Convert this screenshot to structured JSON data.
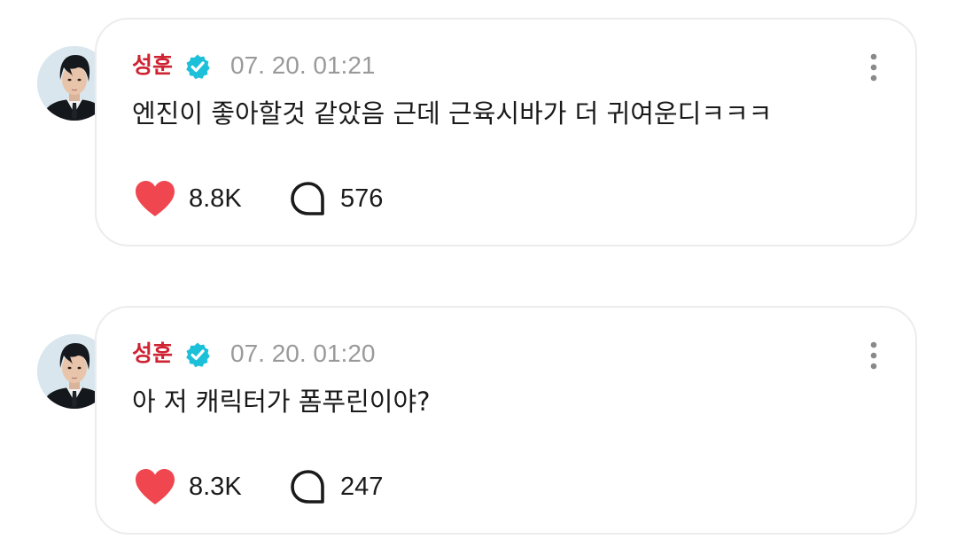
{
  "posts": [
    {
      "author": "성훈",
      "verified_icon": "verified-check-badge",
      "timestamp": "07. 20. 01:21",
      "text": "엔진이 좋아할것 같았음 근데 근육시바가 더 귀여운디ㅋㅋㅋ",
      "likes": "8.8K",
      "comments": "576"
    },
    {
      "author": "성훈",
      "verified_icon": "verified-check-badge",
      "timestamp": "07. 20. 01:20",
      "text": "아 저 캐릭터가 폼푸린이야?",
      "likes": "8.3K",
      "comments": "247"
    }
  ],
  "colors": {
    "author": "#cf2232",
    "verified": "#1cc0d9",
    "like": "#f0464f",
    "timestamp": "#9a9a9a",
    "card_border": "#ececec"
  }
}
